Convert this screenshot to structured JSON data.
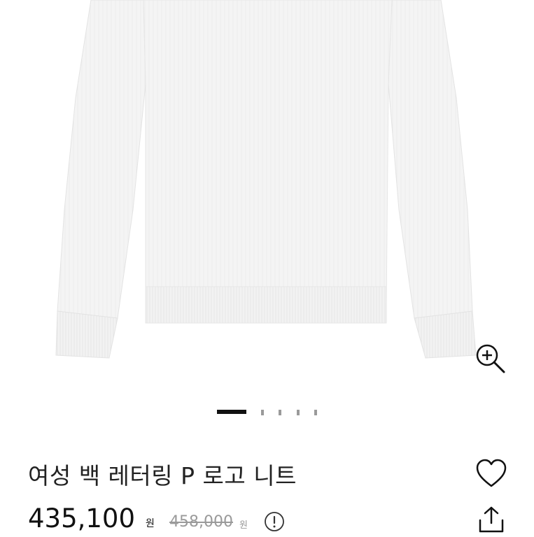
{
  "product": {
    "title": "여성 백 레터링 P 로고 니트",
    "sale_price": "435,100",
    "sale_price_unit": "원",
    "original_price": "458,000",
    "original_price_unit": "원",
    "image_alt": "white knit sweater"
  },
  "carousel": {
    "total_slides": 5,
    "active_index": 0
  },
  "icons": {
    "zoom": "zoom-in-icon",
    "wishlist": "heart-icon",
    "share": "share-icon",
    "info": "info-icon"
  },
  "colors": {
    "text_primary": "#111111",
    "text_muted": "#9a9a9a",
    "background": "#ffffff",
    "sweater": "#f4f4f4"
  }
}
